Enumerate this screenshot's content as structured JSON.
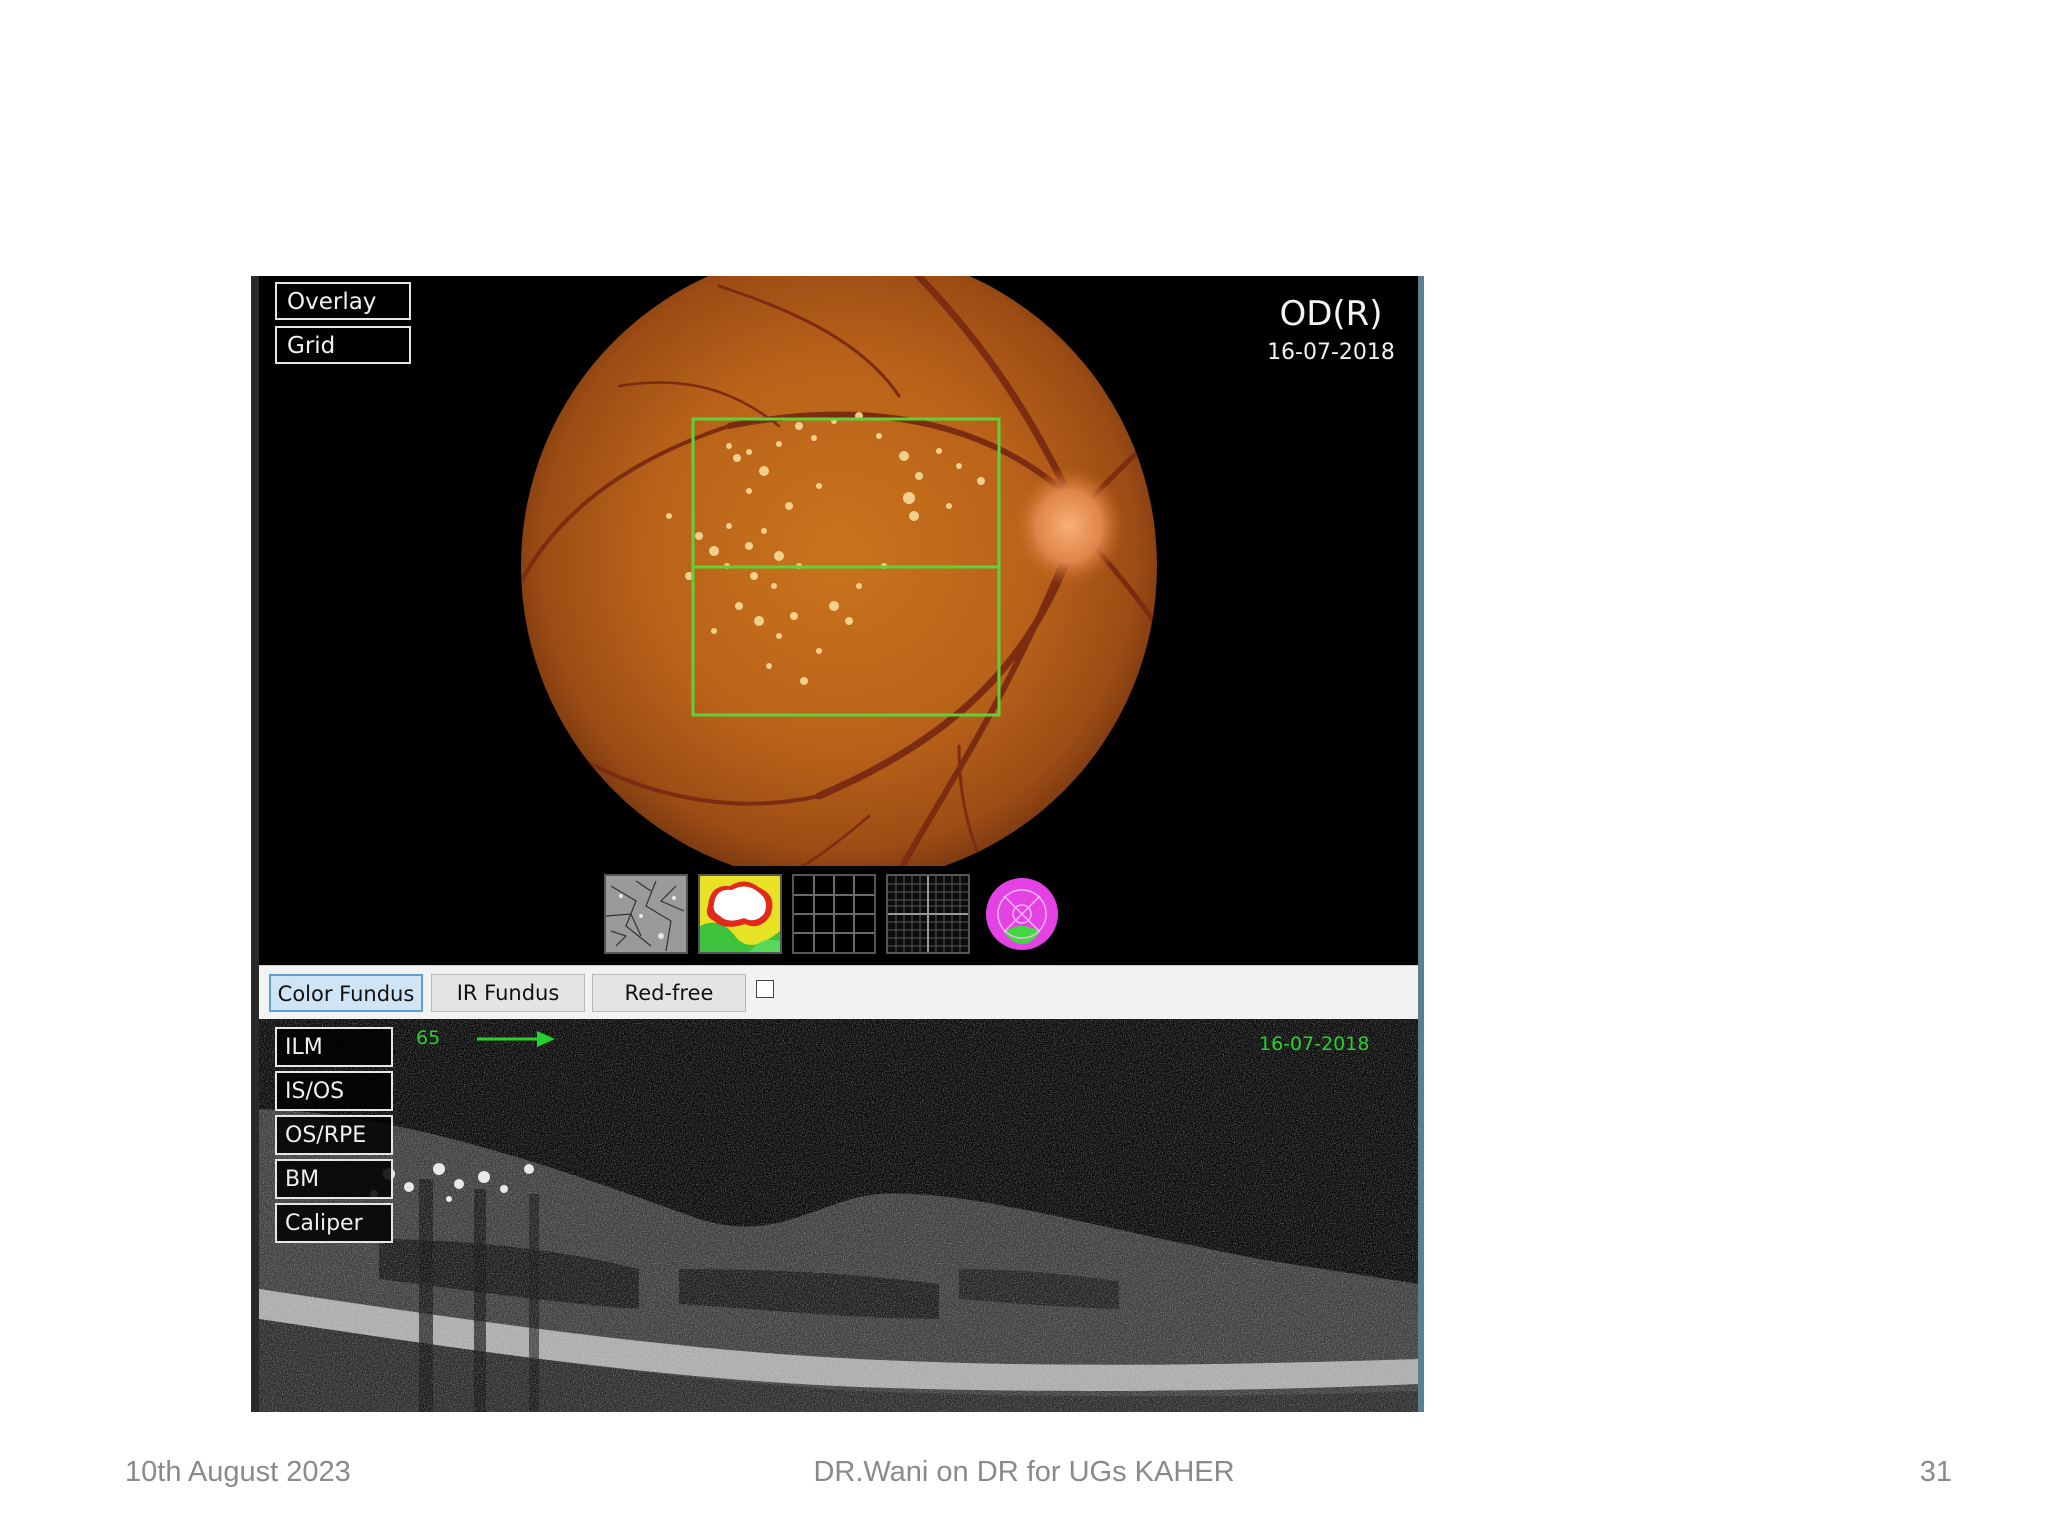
{
  "fundus": {
    "overlay_buttons": [
      "Overlay",
      "Grid"
    ],
    "eye": "OD(R)",
    "date": "16-07-2018",
    "thumbnails": [
      "fundus-texture-thumbnail",
      "thickness-map-thumbnail",
      "grid-thumbnail",
      "fine-grid-thumbnail",
      "etdrs-circle-thumbnail"
    ]
  },
  "toolbar": {
    "tabs": [
      {
        "label": "Color Fundus",
        "active": true
      },
      {
        "label": "IR Fundus",
        "active": false
      },
      {
        "label": "Red-free",
        "active": false
      }
    ],
    "checkbox_checked": false
  },
  "oct": {
    "layer_buttons": [
      "ILM",
      "IS/OS",
      "OS/RPE",
      "BM",
      "Caliper"
    ],
    "scan_number": "65",
    "date": "16-07-2018"
  },
  "slide": {
    "date": "10th August 2023",
    "title": "DR.Wani  on DR for UGs  KAHER",
    "page": "31"
  },
  "colors": {
    "scan_green": "#27d12c",
    "grid_green": "#5fd23a",
    "active_tab": "#cfe4f5"
  }
}
